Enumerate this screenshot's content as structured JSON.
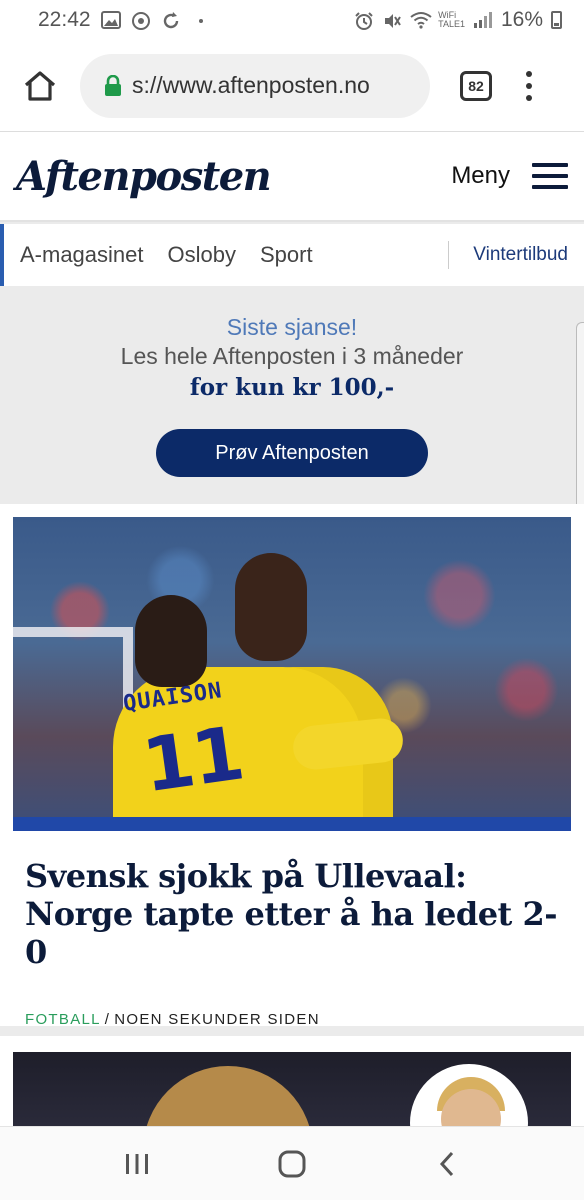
{
  "status_bar": {
    "time": "22:42",
    "wifi_label_top": "WiFi",
    "wifi_label_bottom": "TALE1",
    "battery_percent": "16%"
  },
  "browser": {
    "url": "s://www.aftenposten.no",
    "tab_count": "82"
  },
  "site_header": {
    "logo_text": "Aftenposten",
    "menu_label": "Meny"
  },
  "section_nav": {
    "items": [
      "A-magasinet",
      "Osloby",
      "Sport"
    ],
    "offer": "Vintertilbud"
  },
  "promo": {
    "line1": "Siste sjanse!",
    "line2": "Les hele Aftenposten i 3 måneder",
    "line3": "for kun kr 100,-",
    "button_label": "Prøv Aftenposten"
  },
  "article": {
    "image_jersey_name": "QUAISON",
    "image_jersey_number": "11",
    "headline": "Svensk sjokk på Ullevaal: Norge tapte etter å ha ledet 2-0",
    "category": "FOTBALL",
    "separator": "/",
    "timestamp": "NOEN SEKUNDER SIDEN"
  },
  "colors": {
    "brand_navy": "#0c1b3a",
    "promo_button": "#0c2a68",
    "category_green": "#2a9d5c",
    "link_blue": "#1c3a7a"
  }
}
